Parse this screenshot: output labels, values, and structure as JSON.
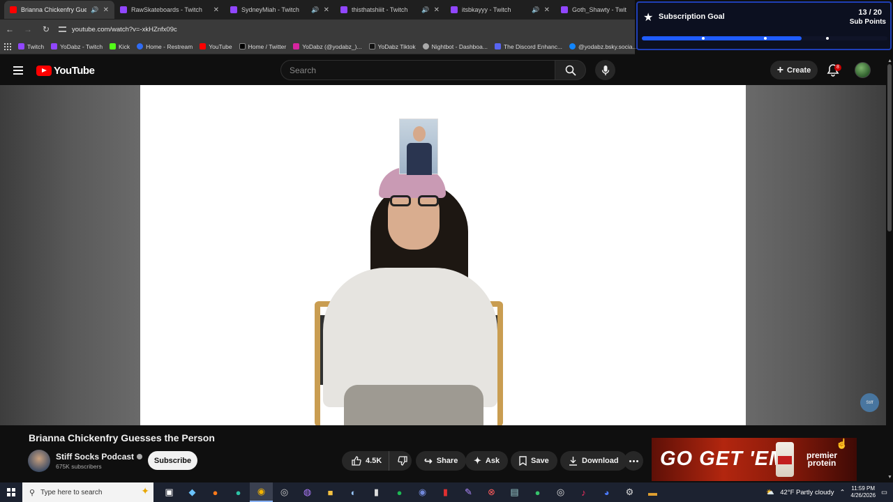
{
  "browser": {
    "tabs": [
      {
        "title": "Brianna Chickenfry Guesses",
        "color": "#ff0000",
        "active": true,
        "sound": true
      },
      {
        "title": "RawSkateboards - Twitch",
        "color": "#9146ff",
        "active": false,
        "sound": false
      },
      {
        "title": "SydneyMiah - Twitch",
        "color": "#9146ff",
        "active": false,
        "sound": true
      },
      {
        "title": "thisthatshiiit - Twitch",
        "color": "#9146ff",
        "active": false,
        "sound": true
      },
      {
        "title": "itsbkayyy - Twitch",
        "color": "#9146ff",
        "active": false,
        "sound": true
      },
      {
        "title": "Goth_Shawty - Twitch",
        "color": "#9146ff",
        "active": false,
        "sound": false
      }
    ],
    "url": "youtube.com/watch?v=-xkHZnfx09c",
    "bookmarks": [
      {
        "label": "Twitch",
        "color": "#9146ff"
      },
      {
        "label": "YoDabz - Twitch",
        "color": "#9146ff"
      },
      {
        "label": "Kick",
        "color": "#53fc18"
      },
      {
        "label": "Home - Restream",
        "color": "#2f6cf5"
      },
      {
        "label": "YouTube",
        "color": "#ff0000"
      },
      {
        "label": "Home / Twitter",
        "color": "#000000"
      },
      {
        "label": "YoDabz (@yodabz_)...",
        "color": "#d6249f"
      },
      {
        "label": "YoDabz Tiktok",
        "color": "#111111"
      },
      {
        "label": "Nightbot - Dashboa...",
        "color": "#aaaaaa"
      },
      {
        "label": "The Discord Enhanc...",
        "color": "#5865f2"
      },
      {
        "label": "@yodabz.bsky.socia...",
        "color": "#1185fe"
      }
    ]
  },
  "sub_goal": {
    "title": "Subscription Goal",
    "count": "13 / 20",
    "unit": "Sub Points",
    "progress": 0.65,
    "accent": "#1f5cff"
  },
  "youtube": {
    "logo_text": "YouTube",
    "search_placeholder": "Search",
    "create_label": "Create",
    "notification_count": "8"
  },
  "video": {
    "title": "Brianna Chickenfry Guesses the Person",
    "channel_name": "Stiff Socks Podcast",
    "subscribers": "675K subscribers",
    "subscribe_label": "Subscribe",
    "likes": "4.5K",
    "share_label": "Share",
    "ask_label": "Ask",
    "save_label": "Save",
    "download_label": "Download",
    "watermark": "Stiff"
  },
  "ad": {
    "slogan": "GO GET 'EM",
    "brand_line1": "premier",
    "brand_line2": "protein"
  },
  "taskbar": {
    "search_placeholder": "Type here to search",
    "weather": "42°F  Partly cloudy",
    "time": "11:59 PM",
    "date": "4/26/2026"
  }
}
